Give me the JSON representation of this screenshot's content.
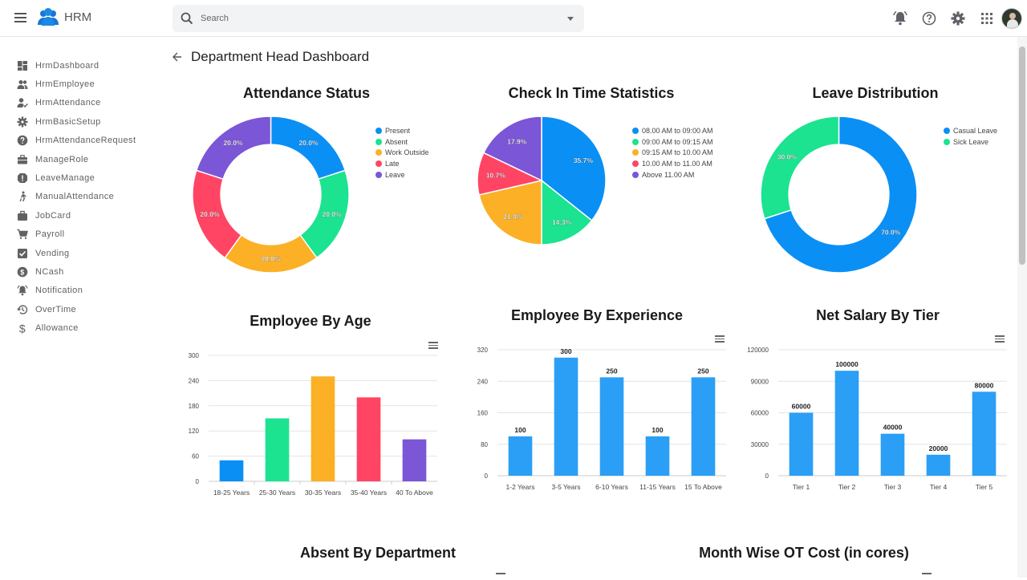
{
  "header": {
    "app_name": "HRM",
    "search_placeholder": "Search"
  },
  "sidebar": {
    "items": [
      {
        "label": "HrmDashboard",
        "icon": "dashboard-icon"
      },
      {
        "label": "HrmEmployee",
        "icon": "people-icon"
      },
      {
        "label": "HrmAttendance",
        "icon": "person-check-icon"
      },
      {
        "label": "HrmBasicSetup",
        "icon": "gear-icon"
      },
      {
        "label": "HrmAttendanceRequest",
        "icon": "help-icon"
      },
      {
        "label": "ManageRole",
        "icon": "briefcase-icon"
      },
      {
        "label": "LeaveManage",
        "icon": "report-icon"
      },
      {
        "label": "ManualAttendance",
        "icon": "walk-icon"
      },
      {
        "label": "JobCard",
        "icon": "work-icon"
      },
      {
        "label": "Payroll",
        "icon": "cart-icon"
      },
      {
        "label": "Vending",
        "icon": "checkbox-icon"
      },
      {
        "label": "NCash",
        "icon": "dollar-circle-icon"
      },
      {
        "label": "Notification",
        "icon": "bell-icon"
      },
      {
        "label": "OverTime",
        "icon": "history-icon"
      },
      {
        "label": "Allowance",
        "icon": "dollar-icon"
      }
    ]
  },
  "page": {
    "title": "Department Head Dashboard"
  },
  "colors": {
    "blue": "#0a8ff5",
    "green": "#1be38f",
    "orange": "#fbb026",
    "red": "#ff4563",
    "purple": "#7b56d6",
    "bar_blue": "#2b9ff5"
  },
  "chart_data": [
    {
      "type": "pie",
      "title": "Attendance Status",
      "labels": [
        "Present",
        "Absent",
        "Work Outside",
        "Late",
        "Leave"
      ],
      "values": [
        20.0,
        20.0,
        20.0,
        20.0,
        20.0
      ],
      "value_labels": [
        "20.0%",
        "20.0%",
        "20.0%",
        "20.0%",
        "20.0%"
      ],
      "donut": true,
      "legend": "right"
    },
    {
      "type": "pie",
      "title": "Check In Time Statistics",
      "labels": [
        "08.00 AM to 09:00 AM",
        "09:00 AM to 09:15 AM",
        "09:15 AM to 10.00 AM",
        "10.00 AM to 11.00 AM",
        "Above 11.00 AM"
      ],
      "values": [
        35.7,
        14.3,
        21.4,
        10.7,
        17.9
      ],
      "value_labels": [
        "35.7%",
        "14.3%",
        "21.4%",
        "10.7%",
        "17.9%"
      ],
      "donut": false,
      "legend": "right"
    },
    {
      "type": "pie",
      "title": "Leave Distribution",
      "labels": [
        "Casual Leave",
        "Sick Leave"
      ],
      "values": [
        70.0,
        30.0
      ],
      "value_labels": [
        "70.0%",
        "30.0%"
      ],
      "donut": true,
      "legend": "right"
    },
    {
      "type": "bar",
      "title": "Employee By Age",
      "categories": [
        "18-25 Years",
        "25-30 Years",
        "30-35 Years",
        "35-40 Years",
        "40 To Above"
      ],
      "values": [
        50,
        150,
        250,
        200,
        100
      ],
      "ylim": [
        0,
        300
      ],
      "yticks": [
        "300",
        "240",
        "180",
        "120",
        "60",
        "0"
      ],
      "multicolor": true,
      "data_labels": false
    },
    {
      "type": "bar",
      "title": "Employee By Experience",
      "categories": [
        "1-2 Years",
        "3-5 Years",
        "6-10 Years",
        "11-15 Years",
        "15 To Above"
      ],
      "values": [
        100,
        300,
        250,
        100,
        250
      ],
      "value_labels": [
        "100",
        "300",
        "250",
        "100",
        "250"
      ],
      "ylim": [
        0,
        320
      ],
      "yticks": [
        "320",
        "240",
        "160",
        "80",
        "0"
      ],
      "multicolor": false,
      "data_labels": true
    },
    {
      "type": "bar",
      "title": "Net Salary By Tier",
      "categories": [
        "Tier 1",
        "Tier 2",
        "Tier 3",
        "Tier 4",
        "Tier 5"
      ],
      "values": [
        60000,
        100000,
        40000,
        20000,
        80000
      ],
      "value_labels": [
        "60000",
        "100000",
        "40000",
        "20000",
        "80000"
      ],
      "ylim": [
        0,
        120000
      ],
      "yticks": [
        "120000",
        "90000",
        "60000",
        "30000",
        "0"
      ],
      "multicolor": false,
      "data_labels": true
    }
  ],
  "lower_sections": {
    "absent_title": "Absent By Department",
    "ot_title": "Month Wise OT Cost (in cores)"
  }
}
